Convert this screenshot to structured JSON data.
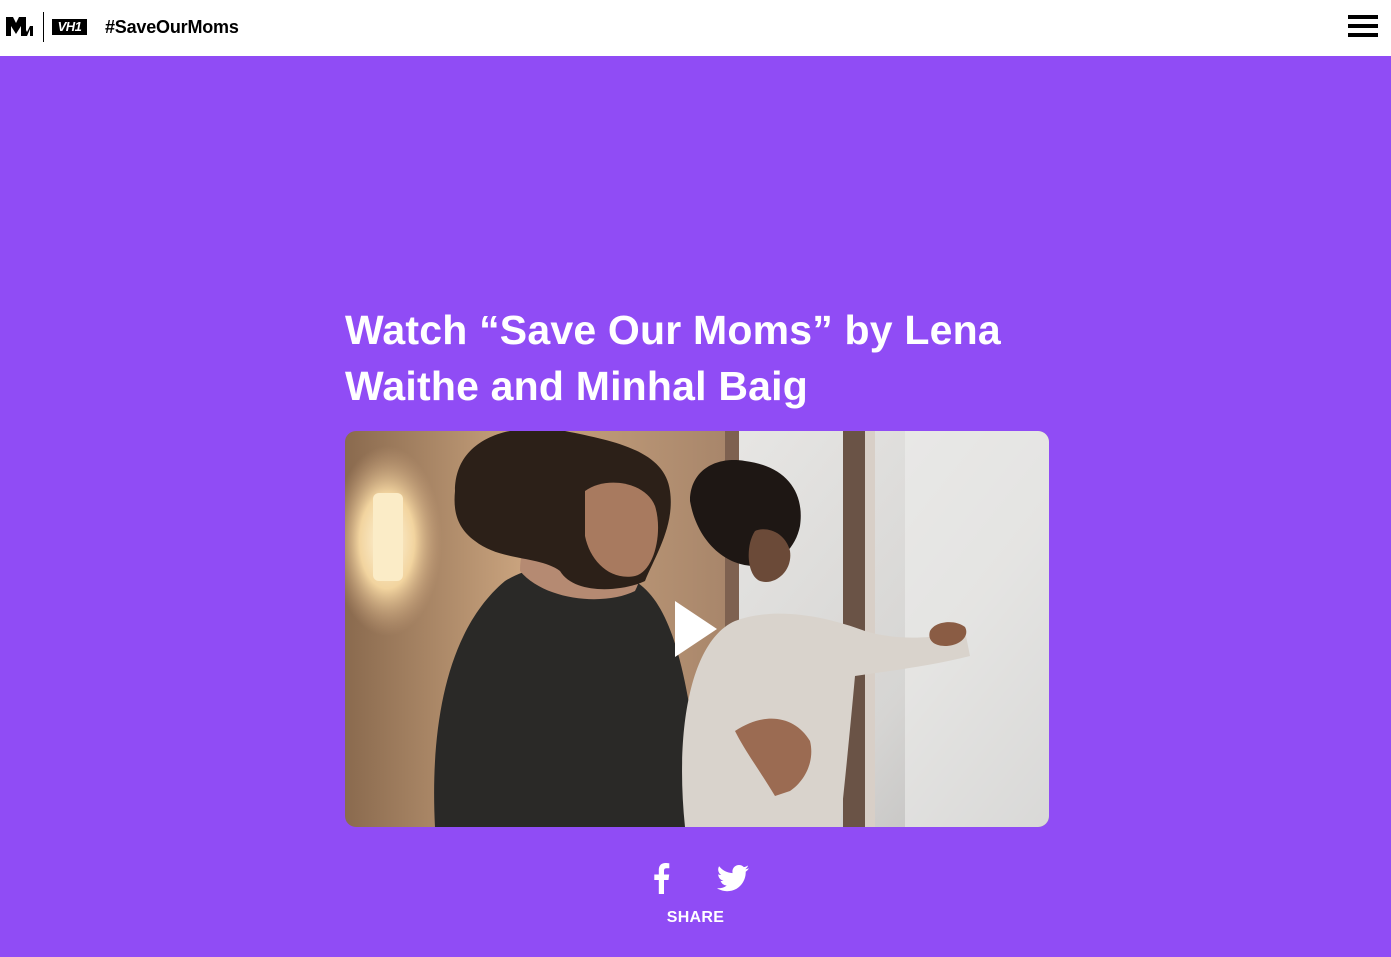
{
  "header": {
    "brand_primary": "MTV",
    "brand_secondary": "VH1",
    "title": "#SaveOurMoms",
    "menu_icon": "hamburger-menu-icon"
  },
  "hero": {
    "headline": "Watch “Save Our Moms” by Lena Waithe and Minhal Baig"
  },
  "video": {
    "play_icon": "play-icon",
    "thumbnail": "woman holding toddler by window"
  },
  "share": {
    "facebook_icon": "facebook-icon",
    "twitter_icon": "twitter-icon",
    "label": "SHARE"
  },
  "colors": {
    "background": "#904cf5",
    "header_bg": "#ffffff",
    "text_on_accent": "#ffffff"
  }
}
